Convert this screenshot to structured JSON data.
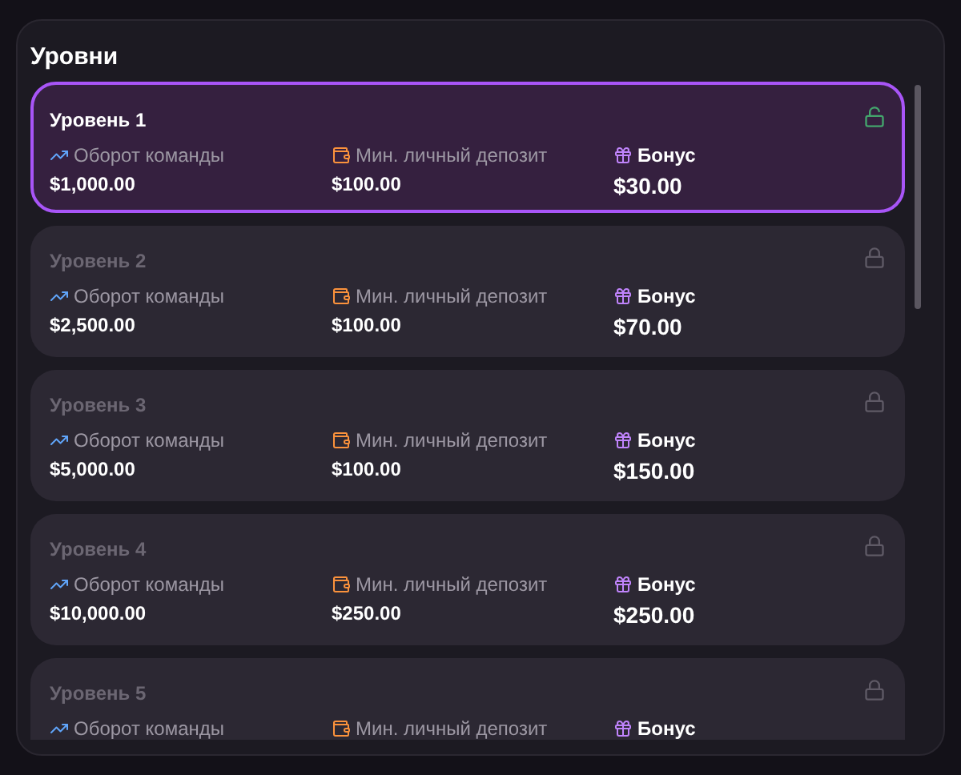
{
  "title": "Уровни",
  "levels": [
    {
      "name": "Уровень 1",
      "selected": true,
      "unlocked": true,
      "turnover_label": "Оборот команды",
      "turnover": "$1,000.00",
      "deposit_label": "Мин. личный депозит",
      "deposit": "$100.00",
      "bonus_label": "Бонус",
      "bonus": "$30.00"
    },
    {
      "name": "Уровень 2",
      "selected": false,
      "unlocked": false,
      "turnover_label": "Оборот команды",
      "turnover": "$2,500.00",
      "deposit_label": "Мин. личный депозит",
      "deposit": "$100.00",
      "bonus_label": "Бонус",
      "bonus": "$70.00"
    },
    {
      "name": "Уровень 3",
      "selected": false,
      "unlocked": false,
      "turnover_label": "Оборот команды",
      "turnover": "$5,000.00",
      "deposit_label": "Мин. личный депозит",
      "deposit": "$100.00",
      "bonus_label": "Бонус",
      "bonus": "$150.00"
    },
    {
      "name": "Уровень 4",
      "selected": false,
      "unlocked": false,
      "turnover_label": "Оборот команды",
      "turnover": "$10,000.00",
      "deposit_label": "Мин. личный депозит",
      "deposit": "$250.00",
      "bonus_label": "Бонус",
      "bonus": "$250.00"
    },
    {
      "name": "Уровень 5",
      "selected": false,
      "unlocked": false,
      "turnover_label": "Оборот команды",
      "deposit_label": "Мин. личный депозит",
      "bonus_label": "Бонус"
    }
  ]
}
